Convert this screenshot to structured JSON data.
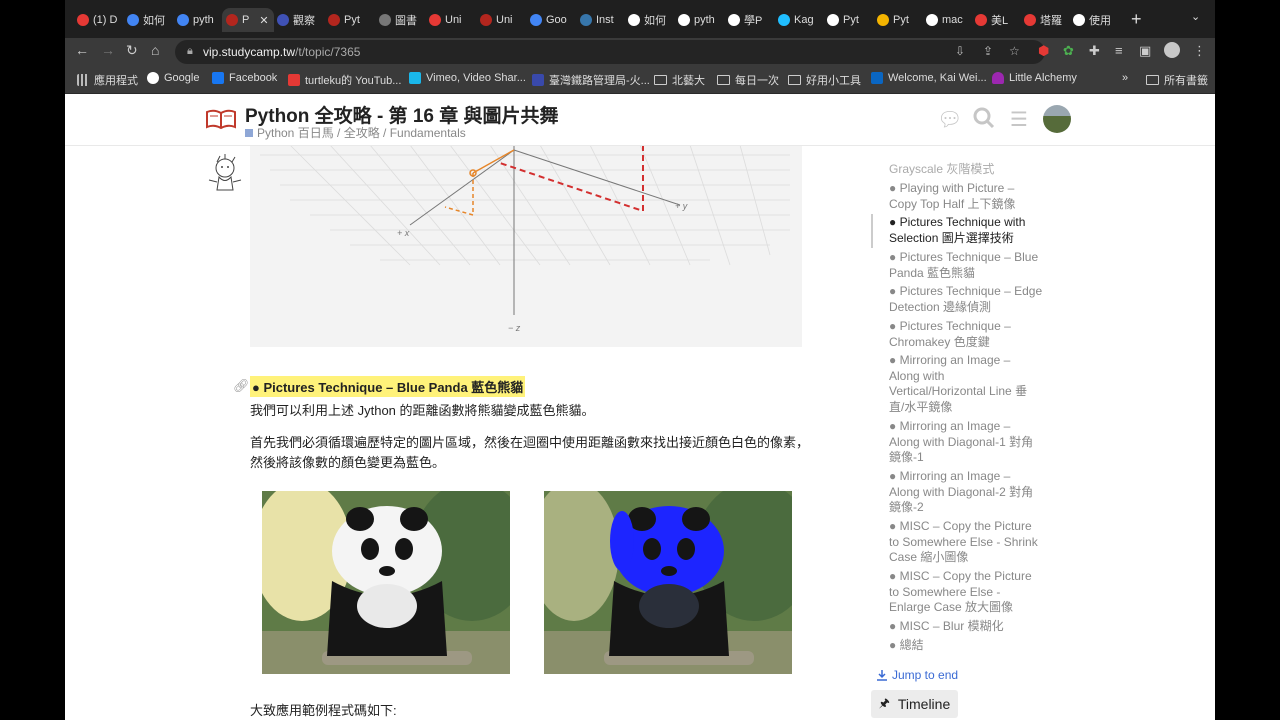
{
  "browser": {
    "tabs": [
      {
        "label": "(1) D",
        "color": "#e53935"
      },
      {
        "label": "如何",
        "color": "#4285f4"
      },
      {
        "label": "pyth",
        "color": "#4285f4"
      },
      {
        "label": "P",
        "color": "#b3261e",
        "active": true
      },
      {
        "label": "觀察",
        "color": "#3f51b5"
      },
      {
        "label": "Pyt",
        "color": "#b3261e"
      },
      {
        "label": "圖書",
        "color": "#777"
      },
      {
        "label": "Uni",
        "color": "#e53935"
      },
      {
        "label": "Uni",
        "color": "#b3261e"
      },
      {
        "label": "Goo",
        "color": "#4285f4"
      },
      {
        "label": "Inst",
        "color": "#3776ab"
      },
      {
        "label": "如何",
        "color": "#ffffff"
      },
      {
        "label": "pyth",
        "color": "#ffffff"
      },
      {
        "label": "學P",
        "color": "#ffffff"
      },
      {
        "label": "Kag",
        "color": "#20beff"
      },
      {
        "label": "Pyt",
        "color": "#ffffff"
      },
      {
        "label": "Pyt",
        "color": "#f4b400"
      },
      {
        "label": "mac",
        "color": "#ffffff"
      },
      {
        "label": "美L",
        "color": "#e53935"
      },
      {
        "label": "塔羅",
        "color": "#e53935"
      },
      {
        "label": "使用",
        "color": "#ffffff"
      }
    ],
    "new_tab": "+",
    "url_host": "vip.studycamp.tw",
    "url_path": "/t/topic/7365",
    "bookmarks": [
      {
        "label": "應用程式",
        "color": "#888"
      },
      {
        "label": "Google",
        "color": "#4285f4"
      },
      {
        "label": "Facebook",
        "color": "#1877f2"
      },
      {
        "label": "turtleku的 YouTub...",
        "color": "#e53935"
      },
      {
        "label": "Vimeo, Video Shar...",
        "color": "#1ab7ea"
      },
      {
        "label": "臺灣鐵路管理局-火...",
        "color": "#3949ab"
      },
      {
        "label": "北藝大",
        "color": "folder"
      },
      {
        "label": "每日一次",
        "color": "folder"
      },
      {
        "label": "好用小工具",
        "color": "folder"
      },
      {
        "label": "Welcome, Kai Wei...",
        "color": "#0a66c2"
      },
      {
        "label": "Little Alchemy",
        "color": "#9c27b0"
      }
    ],
    "bookmarks_more": "»",
    "all_bookmarks": "所有書籤"
  },
  "topic": {
    "title": "Python 全攻略 - 第 16 章 與圖片共舞",
    "breadcrumb": "Python 百日馬 / 全攻略 / Fundamentals"
  },
  "figure": {
    "axis_y": "+ y",
    "axis_x": "+ x",
    "axis_z": "− z"
  },
  "content": {
    "section_heading": "● Pictures Technique – Blue Panda 藍色熊貓",
    "para1": "我們可以利用上述 Jython 的距離函數將熊貓變成藍色熊貓。",
    "para2_line1": "首先我們必須循環遍歷特定的圖片區域，然後在迴圈中使用距離函數來找出接近顏色白色的像素，",
    "para2_line2": "然後將該像數的顏色變更為藍色。",
    "para3": "大致應用範例程式碼如下:"
  },
  "toc": {
    "items": [
      {
        "label": "Grayscale 灰階模式",
        "current": false
      },
      {
        "label": "● Playing with Picture – Copy Top Half 上下鏡像",
        "current": false
      },
      {
        "label": "● Pictures Technique with Selection 圖片選擇技術",
        "current": true
      },
      {
        "label": "● Pictures Technique – Blue Panda 藍色熊貓",
        "current": false
      },
      {
        "label": "● Pictures Technique – Edge Detection 邊緣偵測",
        "current": false
      },
      {
        "label": "● Pictures Technique – Chromakey 色度鍵",
        "current": false
      },
      {
        "label": "● Mirroring an Image – Along with Vertical/Horizontal Line 垂直/水平鏡像",
        "current": false
      },
      {
        "label": "● Mirroring an Image – Along with Diagonal-1 對角鏡像-1",
        "current": false
      },
      {
        "label": "● Mirroring an Image – Along with Diagonal-2 對角鏡像-2",
        "current": false
      },
      {
        "label": "● MISC – Copy the Picture to Somewhere Else - Shrink Case 縮小圖像",
        "current": false
      },
      {
        "label": "● MISC – Copy the Picture to Somewhere Else - Enlarge Case 放大圖像",
        "current": false
      },
      {
        "label": "● MISC – Blur 模糊化",
        "current": false
      },
      {
        "label": "● 總結",
        "current": false
      }
    ],
    "jump_to_end": "Jump to end",
    "timeline": "Timeline"
  }
}
